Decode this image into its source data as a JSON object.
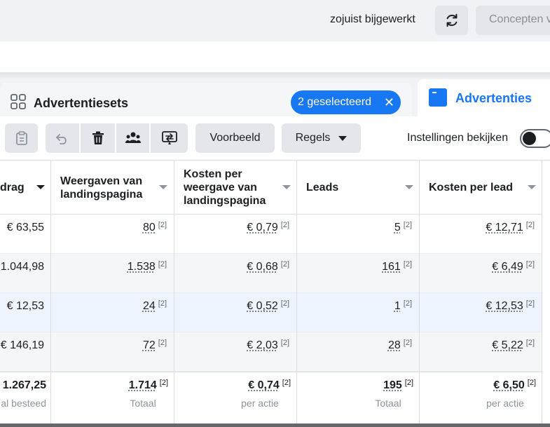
{
  "topbar": {
    "status": "zojuist bijgewerkt",
    "refresh_icon": "refresh-icon",
    "drafts_button": "Concepten v"
  },
  "tabs": {
    "adsets": {
      "label": "Advertentiesets",
      "icon": "grid-icon"
    },
    "selected_pill": "2 geselecteerd",
    "ads": {
      "label": "Advertenties",
      "icon": "ads-icon"
    }
  },
  "toolbar": {
    "icons": [
      "clipboard-icon",
      "undo-icon",
      "trash-icon",
      "users-icon",
      "swap-icon"
    ],
    "preview": "Voorbeeld",
    "rules": "Regels",
    "settings": "Instellingen bekijken",
    "settings_toggle_on": false
  },
  "table": {
    "headers": [
      "drag",
      "Weergaven van landingspagina",
      "Kosten per weergave van landingspagina",
      "Leads",
      "Kosten per lead"
    ],
    "rows": [
      {
        "bedrag": "€ 63,55",
        "views": "80",
        "cost_view": "€ 0,79",
        "leads": "5",
        "cost_lead": "€ 12,71"
      },
      {
        "bedrag": "1.044,98",
        "views": "1.538",
        "cost_view": "€ 0,68",
        "leads": "161",
        "cost_lead": "€ 6,49"
      },
      {
        "bedrag": "€ 12,53",
        "views": "24",
        "cost_view": "€ 0,52",
        "leads": "1",
        "cost_lead": "€ 12,53"
      },
      {
        "bedrag": "€ 146,19",
        "views": "72",
        "cost_view": "€ 2,03",
        "leads": "28",
        "cost_lead": "€ 5,22"
      }
    ],
    "footnote": "[2]",
    "totals": {
      "bedrag": "1.267,25",
      "bedrag_sub": "al besteed",
      "views": "1.714",
      "views_sub": "Totaal",
      "cost_view": "€ 0,74",
      "cost_view_sub": "per actie",
      "leads": "195",
      "leads_sub": "Totaal",
      "cost_lead": "€ 6,50",
      "cost_lead_sub": "per actie"
    },
    "row_colors": [
      "#ffffff",
      "#f5f6f7",
      "#eef4fd",
      "#f5f6f7",
      "#ffffff"
    ]
  }
}
